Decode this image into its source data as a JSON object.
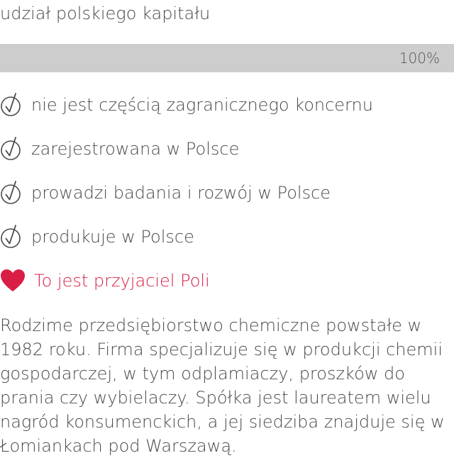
{
  "capital": {
    "label": "udział polskiego kapitału",
    "value_text": "100%",
    "percent": 100
  },
  "criteria": [
    {
      "icon": "checkmark-circle-icon",
      "label": "nie jest częścią zagranicznego koncernu"
    },
    {
      "icon": "checkmark-circle-icon",
      "label": "zarejestrowana w Polsce"
    },
    {
      "icon": "checkmark-circle-icon",
      "label": "prowadzi badania i rozwój w Polsce"
    },
    {
      "icon": "checkmark-circle-icon",
      "label": "produkuje w Polsce"
    }
  ],
  "friend": {
    "icon": "heart-icon",
    "label": "To jest przyjaciel Poli"
  },
  "description": "Rodzime przedsiębiorstwo chemiczne powstałe w 1982 roku. Firma specjalizuje się w produkcji chemii gospodarczej, w tym odplamiaczy, proszków do prania czy wybielaczy. Spółka jest laureatem wielu nagród konsumenckich, a jej siedziba znajduje się w Łomiankach pod Warszawą.",
  "colors": {
    "accent": "#d81e44",
    "text": "#4a4a4a",
    "bar_track": "#e8e8e8",
    "bar_fill": "#cdcdcd"
  }
}
